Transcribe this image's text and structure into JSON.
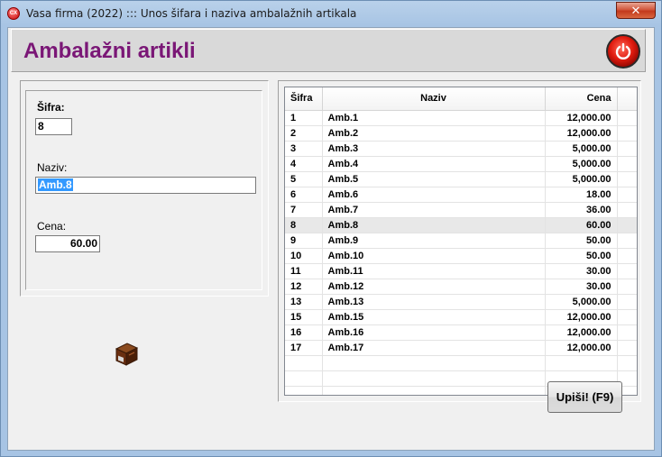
{
  "window": {
    "title": "Vasa firma (2022) ::: Unos šifara i naziva ambalažnih artikala",
    "app_icon_text": "CX",
    "close_label": "✕"
  },
  "header": {
    "title": "Ambalažni artikli"
  },
  "form": {
    "sifra_label": "Šifra:",
    "sifra_value": "8",
    "naziv_label": "Naziv:",
    "naziv_value": "Amb.8",
    "cena_label": "Cena:",
    "cena_value": "60.00"
  },
  "grid": {
    "columns": [
      "Šifra",
      "Naziv",
      "Cena"
    ],
    "selected_sifra": "8",
    "rows": [
      [
        "1",
        "Amb.1",
        "12,000.00"
      ],
      [
        "2",
        "Amb.2",
        "12,000.00"
      ],
      [
        "3",
        "Amb.3",
        "5,000.00"
      ],
      [
        "4",
        "Amb.4",
        "5,000.00"
      ],
      [
        "5",
        "Amb.5",
        "5,000.00"
      ],
      [
        "6",
        "Amb.6",
        "18.00"
      ],
      [
        "7",
        "Amb.7",
        "36.00"
      ],
      [
        "8",
        "Amb.8",
        "60.00"
      ],
      [
        "9",
        "Amb.9",
        "50.00"
      ],
      [
        "10",
        "Amb.10",
        "50.00"
      ],
      [
        "11",
        "Amb.11",
        "30.00"
      ],
      [
        "12",
        "Amb.12",
        "30.00"
      ],
      [
        "13",
        "Amb.13",
        "5,000.00"
      ],
      [
        "15",
        "Amb.15",
        "12,000.00"
      ],
      [
        "16",
        "Amb.16",
        "12,000.00"
      ],
      [
        "17",
        "Amb.17",
        "12,000.00"
      ]
    ],
    "empty_rows": 3
  },
  "buttons": {
    "save_label": "Upiši! (F9)"
  },
  "icons": {
    "app": "app-logo-icon",
    "power": "power-icon",
    "package": "package-box-icon"
  },
  "colors": {
    "title_color": "#7a1776",
    "power_button": "#e01b0f",
    "selection": "#3399ff"
  }
}
